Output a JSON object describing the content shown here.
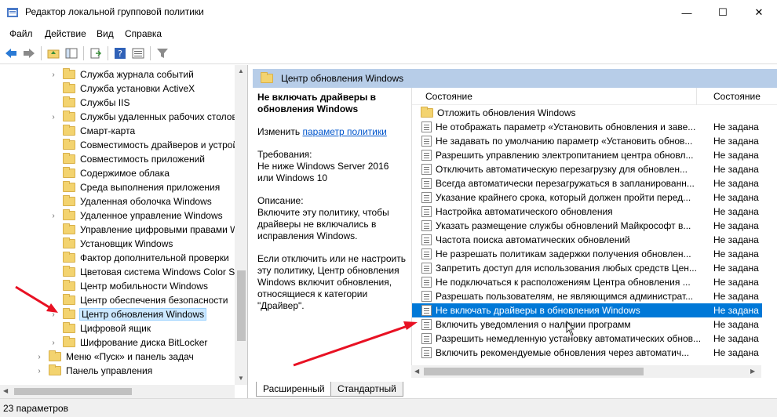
{
  "window": {
    "title": "Редактор локальной групповой политики",
    "minimize": "—",
    "maximize": "☐",
    "close": "✕"
  },
  "menu": [
    "Файл",
    "Действие",
    "Вид",
    "Справка"
  ],
  "toolbar": {
    "icons": [
      "back-arrow-icon",
      "forward-arrow-icon",
      "up-folder-icon",
      "show-tree-icon",
      "export-icon",
      "help-icon",
      "properties-icon",
      "filter-icon"
    ]
  },
  "tree": {
    "items": [
      {
        "label": "Служба журнала событий",
        "chevron": "›"
      },
      {
        "label": "Служба установки ActiveX",
        "chevron": ""
      },
      {
        "label": "Службы IIS",
        "chevron": ""
      },
      {
        "label": "Службы удаленных рабочих столов",
        "chevron": "›"
      },
      {
        "label": "Смарт-карта",
        "chevron": ""
      },
      {
        "label": "Совместимость драйверов и устройств",
        "chevron": ""
      },
      {
        "label": "Совместимость приложений",
        "chevron": ""
      },
      {
        "label": "Содержимое облака",
        "chevron": ""
      },
      {
        "label": "Среда выполнения приложения",
        "chevron": ""
      },
      {
        "label": "Удаленная оболочка Windows",
        "chevron": ""
      },
      {
        "label": "Удаленное управление Windows",
        "chevron": "›"
      },
      {
        "label": "Управление цифровыми правами Windows",
        "chevron": ""
      },
      {
        "label": "Установщик Windows",
        "chevron": ""
      },
      {
        "label": "Фактор дополнительной проверки",
        "chevron": ""
      },
      {
        "label": "Цветовая система Windows Color System",
        "chevron": ""
      },
      {
        "label": "Центр мобильности Windows",
        "chevron": ""
      },
      {
        "label": "Центр обеспечения безопасности",
        "chevron": ""
      },
      {
        "label": "Центр обновления Windows",
        "chevron": "›"
      },
      {
        "label": "Цифровой ящик",
        "chevron": ""
      },
      {
        "label": "Шифрование диска BitLocker",
        "chevron": "›"
      },
      {
        "label": "Меню «Пуск» и панель задач",
        "chevron": "›"
      },
      {
        "label": "Панель управления",
        "chevron": "›"
      }
    ]
  },
  "right": {
    "header": "Центр обновления Windows",
    "desc": {
      "title": "Не включать драйверы в обновления Windows",
      "edit_prefix": "Изменить",
      "edit_link": "параметр политики",
      "requirements_label": "Требования:",
      "requirements": "Не ниже Windows Server 2016 или Windows 10",
      "description_label": "Описание:",
      "description": "Включите эту политику, чтобы драйверы не включались в исправления Windows.",
      "details": "Если отключить или не настроить эту политику, Центр обновления Windows включит обновления, относящиеся к категории \"Драйвер\"."
    },
    "columns": {
      "name": "Состояние",
      "state": "Состояние"
    },
    "rows": [
      {
        "name": "Отложить обновления Windows",
        "state": "",
        "icon": "folder-icon"
      },
      {
        "name": "Не отображать параметр «Установить обновления и заве...",
        "state": "Не задана",
        "icon": "policy-icon"
      },
      {
        "name": "Не задавать по умолчанию параметр «Установить обнов...",
        "state": "Не задана",
        "icon": "policy-icon"
      },
      {
        "name": "Разрешить управлению электропитанием центра обновл...",
        "state": "Не задана",
        "icon": "policy-icon"
      },
      {
        "name": "Отключить автоматическую перезагрузку для обновлен...",
        "state": "Не задана",
        "icon": "policy-icon"
      },
      {
        "name": "Всегда автоматически перезагружаться в запланированн...",
        "state": "Не задана",
        "icon": "policy-icon"
      },
      {
        "name": "Указание крайнего срока, который должен пройти перед...",
        "state": "Не задана",
        "icon": "policy-icon"
      },
      {
        "name": "Настройка автоматического обновления",
        "state": "Не задана",
        "icon": "policy-icon"
      },
      {
        "name": "Указать размещение службы обновлений Майкрософт в...",
        "state": "Не задана",
        "icon": "policy-icon"
      },
      {
        "name": "Частота поиска автоматических обновлений",
        "state": "Не задана",
        "icon": "policy-icon"
      },
      {
        "name": "Не разрешать политикам задержки получения обновлен...",
        "state": "Не задана",
        "icon": "policy-icon"
      },
      {
        "name": "Запретить доступ для использования любых средств Цен...",
        "state": "Не задана",
        "icon": "policy-icon"
      },
      {
        "name": "Не подключаться к расположениям Центра обновления ...",
        "state": "Не задана",
        "icon": "policy-icon"
      },
      {
        "name": "Разрешать пользователям, не являющимся администрат...",
        "state": "Не задана",
        "icon": "policy-icon"
      },
      {
        "name": "Не включать драйверы в обновления Windows",
        "state": "Не задана",
        "icon": "policy-icon",
        "selected": true
      },
      {
        "name": "Включить уведомления о наличии программ",
        "state": "Не задана",
        "icon": "policy-icon"
      },
      {
        "name": "Разрешить немедленную установку автоматических обнов...",
        "state": "Не задана",
        "icon": "policy-icon"
      },
      {
        "name": "Включить рекомендуемые обновления через автоматич...",
        "state": "Не задана",
        "icon": "policy-icon"
      }
    ],
    "tabs": [
      "Расширенный",
      "Стандартный"
    ]
  },
  "status": "23 параметров",
  "colors": {
    "accent": "#0078d7",
    "header": "#b7cde8",
    "arrow": "#e81123"
  }
}
